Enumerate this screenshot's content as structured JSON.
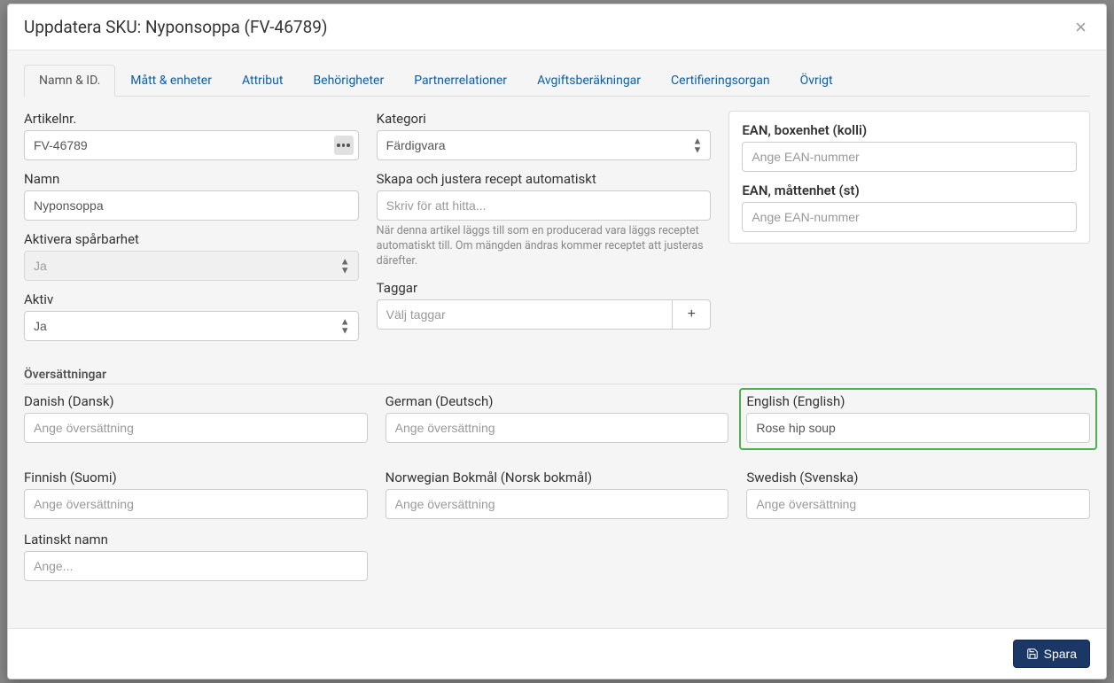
{
  "header": {
    "title": "Uppdatera SKU: Nyponsoppa (FV-46789)"
  },
  "tabs": [
    {
      "label": "Namn & ID.",
      "active": true
    },
    {
      "label": "Mått & enheter"
    },
    {
      "label": "Attribut"
    },
    {
      "label": "Behörigheter"
    },
    {
      "label": "Partnerrelationer"
    },
    {
      "label": "Avgiftsberäkningar"
    },
    {
      "label": "Certifieringsorgan"
    },
    {
      "label": "Övrigt"
    }
  ],
  "fields": {
    "article_no_label": "Artikelnr.",
    "article_no_value": "FV-46789",
    "name_label": "Namn",
    "name_value": "Nyponsoppa",
    "trace_label": "Aktivera spårbarhet",
    "trace_value": "Ja",
    "active_label": "Aktiv",
    "active_value": "Ja",
    "category_label": "Kategori",
    "category_value": "Färdigvara",
    "recipe_label": "Skapa och justera recept automatiskt",
    "recipe_placeholder": "Skriv för att hitta...",
    "recipe_help": "När denna artikel läggs till som en producerad vara läggs receptet automatiskt till. Om mängden ändras kommer receptet att justeras därefter.",
    "tags_label": "Taggar",
    "tags_placeholder": "Välj taggar"
  },
  "side": {
    "ean_box_label": "EAN, boxenhet (kolli)",
    "ean_box_placeholder": "Ange EAN-nummer",
    "ean_unit_label": "EAN, måttenhet (st)",
    "ean_unit_placeholder": "Ange EAN-nummer"
  },
  "translations": {
    "section_title": "Översättningar",
    "placeholder": "Ange översättning",
    "items": [
      {
        "label": "Danish (Dansk)",
        "value": ""
      },
      {
        "label": "German (Deutsch)",
        "value": ""
      },
      {
        "label": "English (English)",
        "value": "Rose hip soup",
        "highlight": true
      },
      {
        "label": "Finnish (Suomi)",
        "value": ""
      },
      {
        "label": "Norwegian Bokmål (Norsk bokmål)",
        "value": ""
      },
      {
        "label": "Swedish (Svenska)",
        "value": ""
      }
    ],
    "latin_label": "Latinskt namn",
    "latin_placeholder": "Ange..."
  },
  "footer": {
    "save_label": "Spara"
  }
}
